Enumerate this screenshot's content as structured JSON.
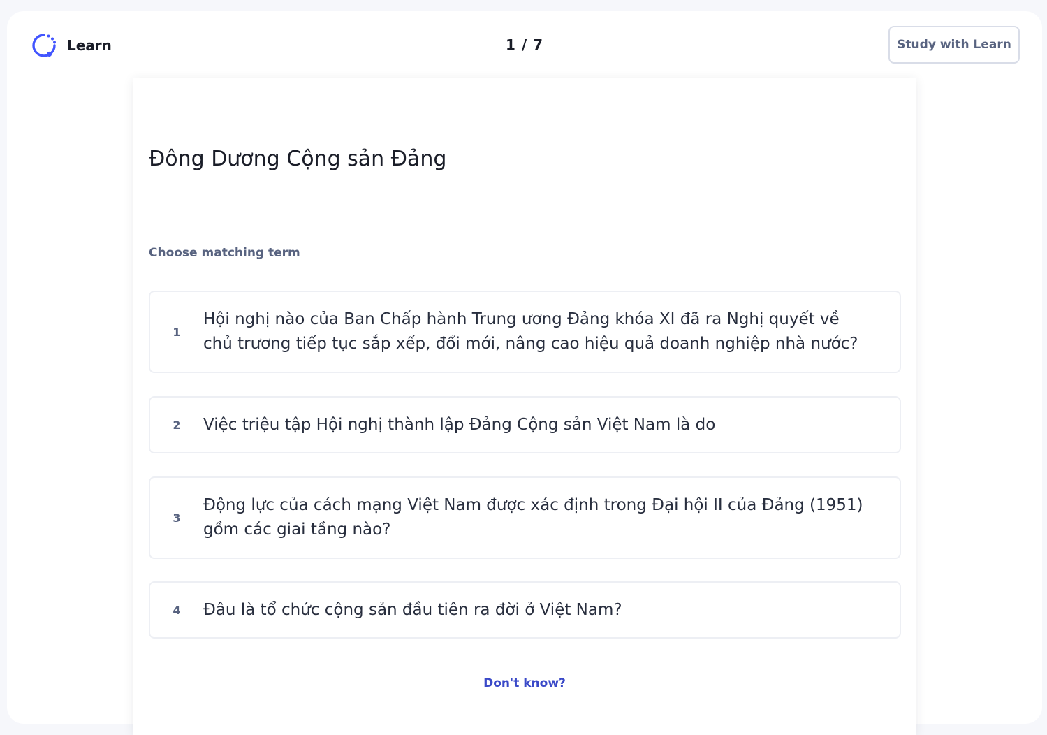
{
  "header": {
    "brand_label": "Learn",
    "brand_icon": "learn-loop-icon",
    "progress": "1 / 7",
    "study_button_label": "Study with Learn"
  },
  "question": {
    "prompt": "Đông Dương Cộng sản Đảng",
    "instruction": "Choose matching term"
  },
  "options": [
    {
      "number": "1",
      "text": "Hội nghị nào của Ban Chấp hành Trung ương Đảng khóa XI đã ra Nghị quyết về chủ trương tiếp tục sắp xếp, đổi mới, nâng cao hiệu quả doanh nghiệp nhà nước?"
    },
    {
      "number": "2",
      "text": "Việc triệu tập Hội nghị thành lập Đảng Cộng sản Việt Nam là do"
    },
    {
      "number": "3",
      "text": "Động lực của cách mạng Việt Nam được xác định trong Đại hội II của Đảng (1951) gồm các giai tầng nào?"
    },
    {
      "number": "4",
      "text": "Đâu là tổ chức cộng sản đầu tiên ra đời ở Việt Nam?"
    }
  ],
  "footer": {
    "dont_know_label": "Don't know?"
  },
  "colors": {
    "accent": "#4255ff",
    "link": "#3a49c8",
    "muted_text": "#586380",
    "border": "#edeff4"
  }
}
